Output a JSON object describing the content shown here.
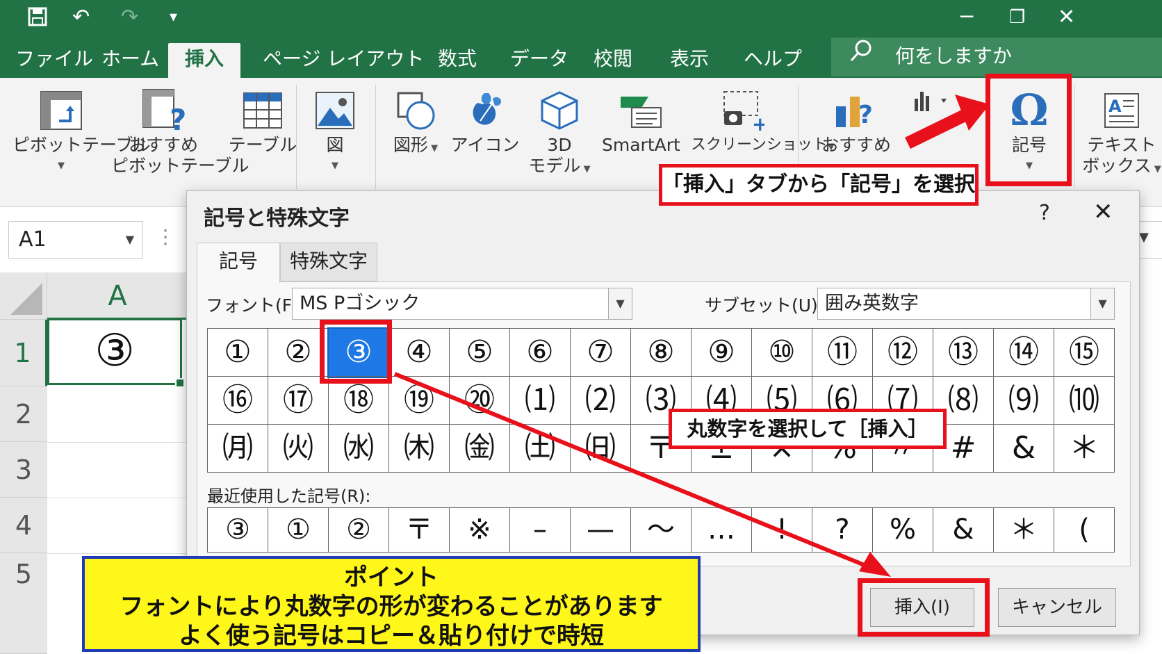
{
  "titlebar": {
    "tabs": [
      "ファイル",
      "ホーム",
      "挿入",
      "ページ レイアウト",
      "数式",
      "データ",
      "校閲",
      "表示",
      "ヘルプ"
    ],
    "active_tab": "挿入",
    "tell_me": "何をしますか"
  },
  "ribbon": {
    "pivot_table": "ピボットテーブル",
    "recommended_pivot_1": "おすすめ",
    "recommended_pivot_2": "ピボットテーブル",
    "table": "テーブル",
    "picture": "図",
    "shapes": "図形",
    "icons": "アイコン",
    "model3d_1": "3D",
    "model3d_2": "モデル",
    "smartart": "SmartArt",
    "screenshot": "スクリーンショット",
    "recommended_charts": "おすすめ",
    "symbol": "記号",
    "textbox_1": "テキスト",
    "textbox_2": "ボックス"
  },
  "sheet": {
    "name_box": "A1",
    "column_a": "A",
    "rows": [
      "1",
      "2",
      "3",
      "4",
      "5"
    ],
    "cell_a1": "③"
  },
  "dialog": {
    "title": "記号と特殊文字",
    "help": "?",
    "close": "✕",
    "tabs": [
      "記号",
      "特殊文字"
    ],
    "font_label": "フォント(F):",
    "font_value": "MS Pゴシック",
    "subset_label": "サブセット(U):",
    "subset_value": "囲み英数字",
    "symbols": [
      "①",
      "②",
      "③",
      "④",
      "⑤",
      "⑥",
      "⑦",
      "⑧",
      "⑨",
      "⑩",
      "⑪",
      "⑫",
      "⑬",
      "⑭",
      "⑮",
      "⑯",
      "⑰",
      "⑱",
      "⑲",
      "⑳",
      "⑴",
      "⑵",
      "⑶",
      "⑷",
      "⑸",
      "⑹",
      "⑺",
      "⑻",
      "⑼",
      "⑽",
      "㈪",
      "㈫",
      "㈬",
      "㈭",
      "㈮",
      "㈯",
      "㈰",
      "〒",
      "±",
      "×",
      "%",
      "〃",
      "#",
      "&",
      "＊"
    ],
    "selected_index": 2,
    "recent_label": "最近使用した記号(R):",
    "recent": [
      "③",
      "①",
      "②",
      "〒",
      "※",
      "–",
      "—",
      "～",
      "…",
      "!",
      "?",
      "%",
      "&",
      "＊",
      "(",
      ")"
    ],
    "insert_button": "挿入(I)",
    "cancel_button": "キャンセル"
  },
  "annotations": {
    "callout_symbol": "「挿入」タブから「記号」を選択",
    "callout_select": "丸数字を選択して［挿入］",
    "point_title": "ポイント",
    "point_line1": "フォントにより丸数字の形が変わることがあります",
    "point_line2": "よく使う記号はコピー＆貼り付けで時短",
    "highlight_color": "#e8101b",
    "point_bg": "#fff719"
  },
  "colors": {
    "excel_green": "#217346",
    "selection_blue": "#1e78e6"
  }
}
